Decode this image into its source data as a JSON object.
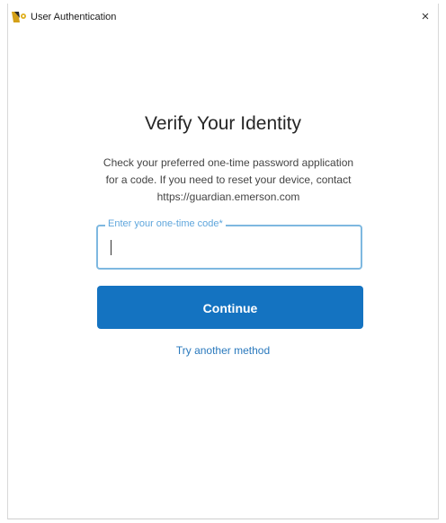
{
  "window": {
    "title": "User Authentication",
    "close_symbol": "×",
    "app_icon": "app-logo-icon"
  },
  "main": {
    "heading": "Verify Your Identity",
    "description": "Check your preferred one-time password application for a code. If you need to reset your device, contact https://guardian.emerson.com",
    "otp_field": {
      "label": "Enter your one-time code*",
      "value": "",
      "focused": true
    },
    "continue_label": "Continue",
    "alt_method_label": "Try another method"
  },
  "colors": {
    "primary_button": "#1473c1",
    "focus_border": "#7eb8e0",
    "link": "#2a79bd"
  }
}
